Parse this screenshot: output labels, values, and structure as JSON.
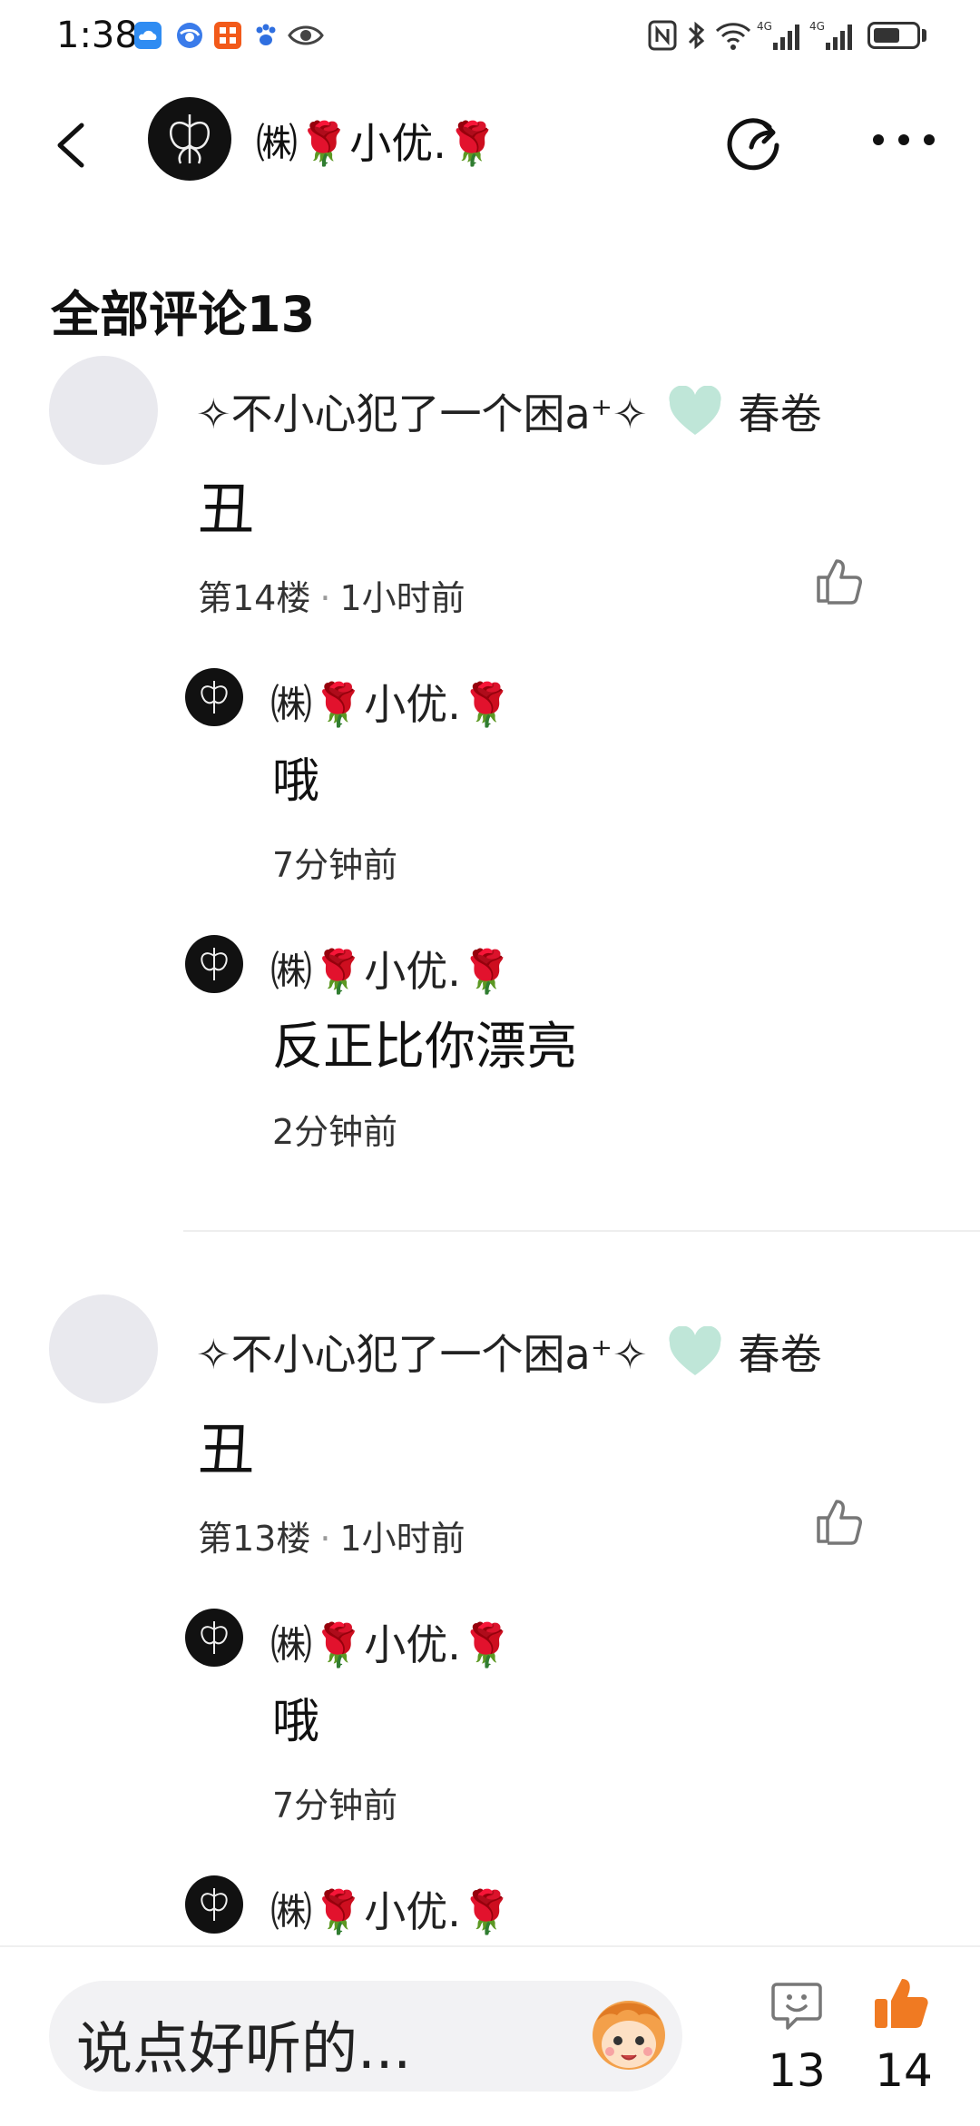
{
  "status_bar": {
    "time": "1:38"
  },
  "header": {
    "title": "㈱🌹小优.🌹"
  },
  "section": {
    "title": "全部评论13"
  },
  "comments": [
    {
      "author": "✧不小心犯了一个困a⁺✧",
      "author_tag": "春卷",
      "body": "丑",
      "floor": "第14楼",
      "time": "1小时前",
      "replies": [
        {
          "author": "㈱🌹小优.🌹",
          "body": "哦",
          "time": "7分钟前"
        },
        {
          "author": "㈱🌹小优.🌹",
          "body": "反正比你漂亮",
          "time": "2分钟前"
        }
      ]
    },
    {
      "author": "✧不小心犯了一个困a⁺✧",
      "author_tag": "春卷",
      "body": "丑",
      "floor": "第13楼",
      "time": "1小时前",
      "replies": [
        {
          "author": "㈱🌹小优.🌹",
          "body": "哦",
          "time": "7分钟前"
        },
        {
          "author": "㈱🌹小优.🌹"
        }
      ]
    }
  ],
  "bottom_bar": {
    "placeholder": "说点好听的...",
    "comment_count": "13",
    "like_count": "14"
  },
  "colors": {
    "like_orange": "#f07a22",
    "heart_mint": "#bfe6d8"
  }
}
